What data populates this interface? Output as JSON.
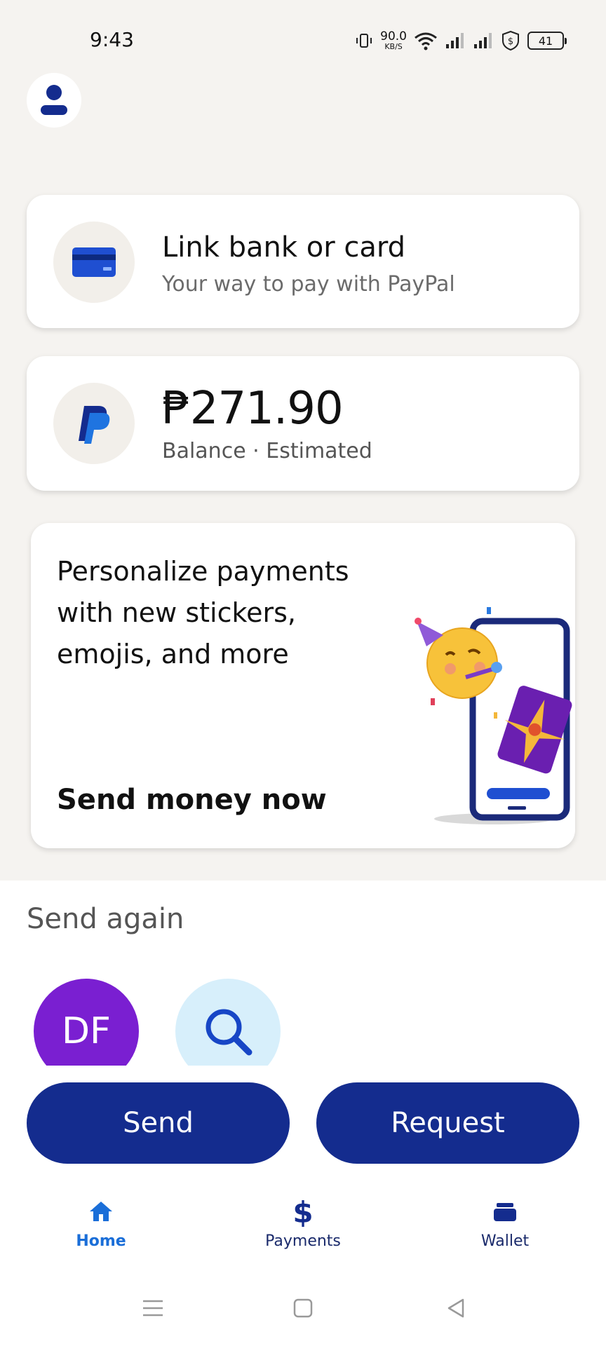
{
  "status_bar": {
    "time": "9:43",
    "net_speed_value": "90.0",
    "net_speed_unit": "KB/S",
    "battery": "41"
  },
  "link_card": {
    "title": "Link bank or card",
    "subtitle": "Your way to pay with PayPal"
  },
  "balance_card": {
    "amount": "₱271.90",
    "subtitle": "Balance · Estimated"
  },
  "promo_card": {
    "text": "Personalize payments with new stickers, emojis, and more",
    "cta": "Send money now"
  },
  "send_again": {
    "title": "Send again",
    "contacts": [
      {
        "initials": "DF",
        "color": "#7a1fd1"
      }
    ]
  },
  "actions": {
    "send_label": "Send",
    "request_label": "Request"
  },
  "tabs": [
    {
      "label": "Home",
      "icon": "home-icon",
      "active": true
    },
    {
      "label": "Payments",
      "icon": "dollar-icon",
      "active": false
    },
    {
      "label": "Wallet",
      "icon": "wallet-icon",
      "active": false
    }
  ],
  "colors": {
    "brand_navy": "#142c8e",
    "active_tab": "#1a6ed8",
    "background": "#f5f3f0"
  }
}
